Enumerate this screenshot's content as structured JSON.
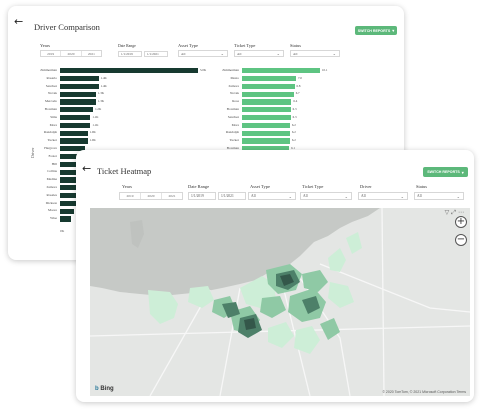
{
  "driver_comparison": {
    "title": "Driver Comparison",
    "switch_label": "SWITCH REPORTS",
    "filters": {
      "years_label": "Years",
      "years": [
        "2019",
        "2020",
        "2021"
      ],
      "date_range_label": "Date Range",
      "date_from": "1/1/2019",
      "date_to": "1/1/2021",
      "asset_type_label": "Asset Type",
      "asset_type_value": "All",
      "ticket_type_label": "Ticket Type",
      "ticket_type_value": "All",
      "status_label": "Status",
      "status_value": "All"
    },
    "left_chart": {
      "axis_label": "Driver",
      "bottom_value": "0K",
      "labels": [
        "Zimmerman",
        "Rosario",
        "Sanchez",
        "Novak",
        "Mercado",
        "Bowman",
        "Sims",
        "Mora",
        "Randolph",
        "Tucker",
        "Hargrove",
        "Foster",
        "Hill",
        "Collins",
        "Medina",
        "Zamora",
        "Rosales",
        "Dickson",
        "Moore",
        "Wise"
      ],
      "values": [
        50,
        14,
        14,
        13,
        13,
        12,
        11,
        11,
        10,
        10,
        9,
        9,
        8,
        8,
        7,
        7,
        6,
        6,
        5,
        4
      ],
      "value_labels": [
        "5.0K",
        "1.4K",
        "1.4K",
        "1.3K",
        "1.3K",
        "1.2K",
        "1.1K",
        "1.1K",
        "1.0K",
        "1.0K",
        "",
        "",
        "",
        "",
        "",
        "",
        "",
        "",
        "",
        ""
      ],
      "color": "#173a30"
    },
    "right_chart": {
      "labels": [
        "Zimmerman",
        "Mesto",
        "Zamora",
        "Novak",
        "Rosa",
        "Bowman",
        "Sanchez",
        "Mora",
        "Randolph",
        "Tucker",
        "Bowman",
        "Foster"
      ],
      "values": [
        10.1,
        7.0,
        6.8,
        6.7,
        6.4,
        6.3,
        6.3,
        6.2,
        6.2,
        6.2,
        6.1,
        6.0
      ],
      "value_labels": [
        "10.1",
        "7.0",
        "6.8",
        "6.7",
        "6.4",
        "6.3",
        "6.3",
        "6.2",
        "6.2",
        "6.2",
        "6.1",
        "6.0"
      ],
      "color": "#5ec482"
    }
  },
  "ticket_heatmap": {
    "title": "Ticket Heatmap",
    "switch_label": "SWITCH REPORTS",
    "filters": {
      "years_label": "Years",
      "years": [
        "2019",
        "2020",
        "2021"
      ],
      "date_range_label": "Date Range",
      "date_from": "1/1/2019",
      "date_to": "1/1/2021",
      "asset_type_label": "Asset Type",
      "asset_type_value": "All",
      "ticket_type_label": "Ticket Type",
      "ticket_type_value": "All",
      "driver_label": "Driver",
      "driver_value": "All",
      "status_label": "Status",
      "status_value": "All"
    },
    "map": {
      "attribution": "Bing",
      "copyright": "© 2020 TomTom, © 2021 Microsoft Corporation Terms",
      "zoom_in": "+",
      "zoom_out": "−",
      "colors": {
        "water": "#c6c9c6",
        "land": "#e4e6e4",
        "low": "#cdeed7",
        "mid": "#8fc9a5",
        "high": "#4d8069",
        "max": "#34574a"
      }
    }
  },
  "icons": {
    "back": "arrow-left-icon",
    "dropdown": "chevron-down-icon",
    "zoom_in": "plus-icon",
    "zoom_out": "minus-icon"
  }
}
